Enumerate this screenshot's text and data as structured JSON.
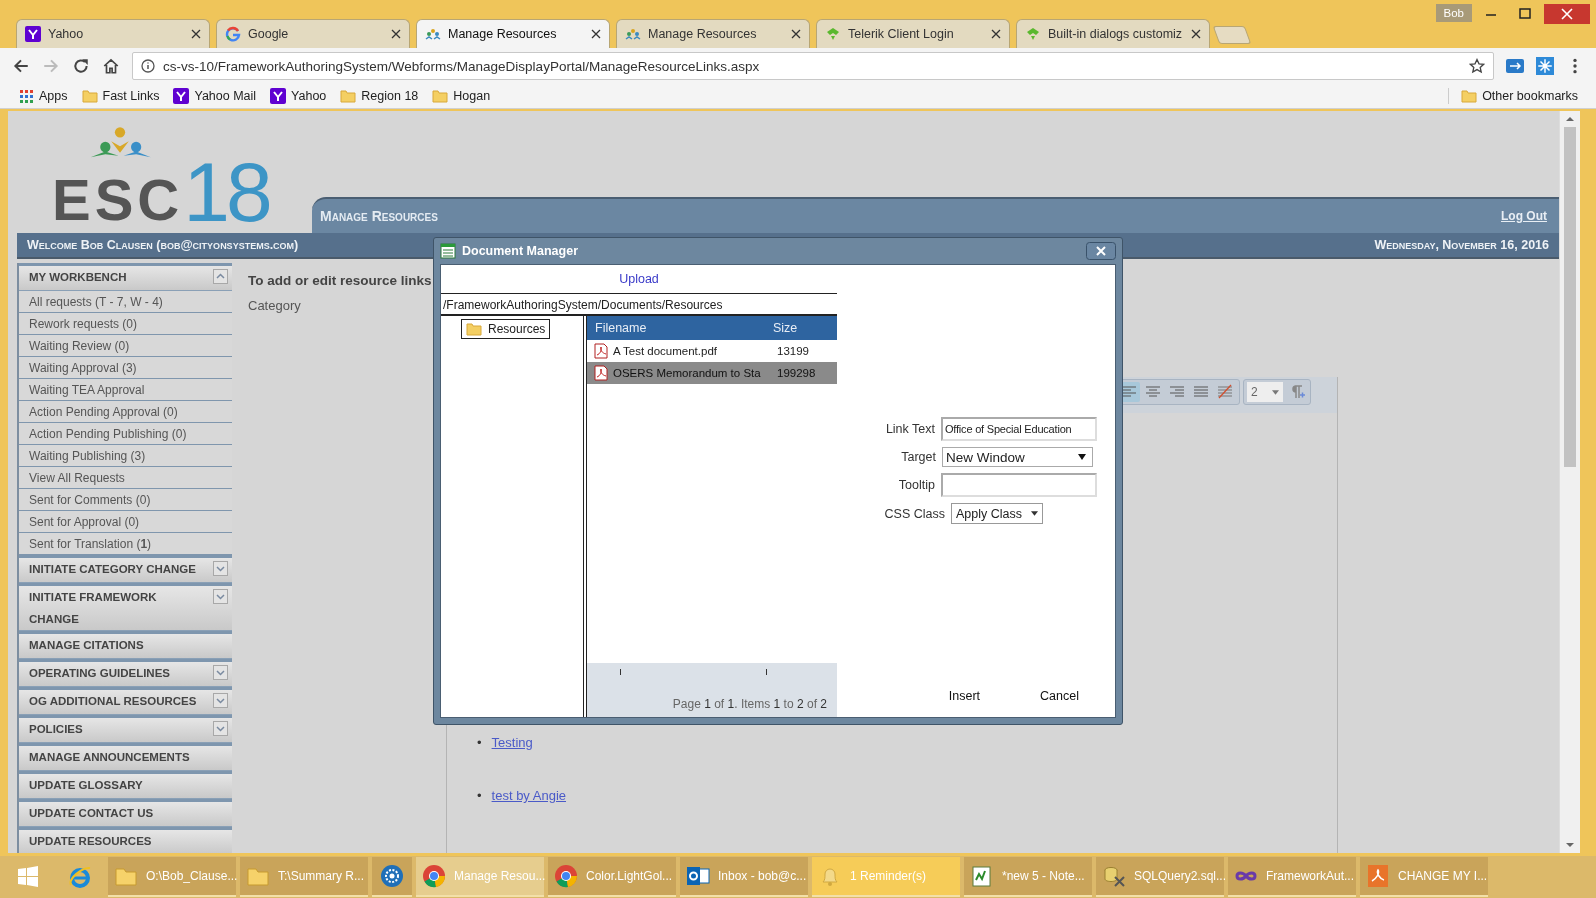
{
  "browser": {
    "profile": "Bob",
    "tabs": [
      {
        "title": "Yahoo",
        "kind": "yahoo",
        "selected": false
      },
      {
        "title": "Google",
        "kind": "google",
        "selected": false
      },
      {
        "title": "Manage Resources",
        "kind": "esc",
        "selected": true
      },
      {
        "title": "Manage Resources",
        "kind": "esc",
        "selected": false
      },
      {
        "title": "Telerik Client Login",
        "kind": "telerik",
        "selected": false
      },
      {
        "title": "Built-in dialogs customiz",
        "kind": "telerik",
        "selected": false
      }
    ],
    "address": "cs-vs-10/FrameworkAuthoringSystem/Webforms/ManageDisplayPortal/ManageResourceLinks.aspx",
    "bookmarks": [
      {
        "label": "Apps",
        "kind": "apps"
      },
      {
        "label": "Fast Links",
        "kind": "folder"
      },
      {
        "label": "Yahoo Mail",
        "kind": "yahoo"
      },
      {
        "label": "Yahoo",
        "kind": "yahoo"
      },
      {
        "label": "Region 18",
        "kind": "folder"
      },
      {
        "label": "Hogan",
        "kind": "folder"
      }
    ],
    "other_bookmarks": "Other bookmarks"
  },
  "page": {
    "logo_letters": "ESC",
    "logo_number": "18",
    "header_title": "Manage Resources",
    "logout": "Log Out",
    "welcome": "Welcome Bob Clausen (bob@cityonsystems.com)",
    "date": "Wednesday, November 16, 2016"
  },
  "sidebar": [
    {
      "label": "MY WORKBENCH",
      "kind": "collapsible",
      "expanded": true,
      "children": [
        "All requests (T - 7, W - 4)",
        "Rework requests (0)",
        "Waiting Review (0)",
        "Waiting Approval (3)",
        "Waiting TEA Approval",
        "Action Pending Approval (0)",
        "Action Pending Publishing (0)",
        "Waiting Publishing (3)",
        "View All Requests",
        "Sent for Comments (0)",
        "Sent for Approval (0)",
        "Sent for Translation (**1**)"
      ]
    },
    {
      "label": "INITIATE CATEGORY CHANGE",
      "kind": "collapsible",
      "expanded": false
    },
    {
      "label": "INITIATE FRAMEWORK CHANGE",
      "kind": "collapsible",
      "expanded": false
    },
    {
      "label": "MANAGE CITATIONS",
      "kind": "link"
    },
    {
      "label": "OPERATING GUIDELINES",
      "kind": "collapsible",
      "expanded": false
    },
    {
      "label": "OG ADDITIONAL RESOURCES",
      "kind": "collapsible",
      "expanded": false
    },
    {
      "label": "POLICIES",
      "kind": "collapsible",
      "expanded": false
    },
    {
      "label": "MANAGE ANNOUNCEMENTS",
      "kind": "link"
    },
    {
      "label": "UPDATE GLOSSARY",
      "kind": "link"
    },
    {
      "label": "UPDATE CONTACT US",
      "kind": "link"
    },
    {
      "label": "UPDATE RESOURCES",
      "kind": "link"
    }
  ],
  "main": {
    "intro": "To add or edit resource links",
    "category_label": "Category",
    "font_size": "2",
    "links": [
      {
        "bullet": "•",
        "text": "Testing"
      },
      {
        "bullet": "•",
        "text": "test by Angie"
      }
    ]
  },
  "dialog": {
    "title": "Document Manager",
    "upload": "Upload",
    "path": "/FrameworkAuthoringSystem/Documents/Resources",
    "folder": "Resources",
    "columns": [
      "Filename",
      "Size"
    ],
    "files": [
      {
        "name": "A Test document.pdf",
        "size": "13199",
        "selected": false
      },
      {
        "name": "OSERS Memorandum to Sta",
        "size": "199298",
        "selected": true
      }
    ],
    "pager": "Page **1** of **1**. Items **1** to **2** of **2**",
    "fields": [
      {
        "label": "Link Text",
        "kind": "text",
        "value": "Office of Special Education"
      },
      {
        "label": "Target",
        "kind": "select",
        "value": "New Window"
      },
      {
        "label": "Tooltip",
        "kind": "text"
      },
      {
        "label": "CSS Class",
        "kind": "dropdown",
        "value": "Apply Class"
      }
    ],
    "buttons": [
      "Insert",
      "Cancel"
    ]
  },
  "taskbar": {
    "pinned": [
      {
        "kind": "start"
      },
      {
        "kind": "ie"
      }
    ],
    "items": [
      {
        "label": "O:\\Bob_Clause...",
        "kind": "folder",
        "selected": false,
        "flashing": false
      },
      {
        "label": "T:\\Summary R...",
        "kind": "folder",
        "selected": false,
        "flashing": false
      },
      {
        "kind": "gear",
        "selected": false,
        "flashing": false
      },
      {
        "label": "Manage Resou...",
        "kind": "chrome",
        "selected": true,
        "flashing": false
      },
      {
        "label": "Color.LightGol...",
        "kind": "chrome",
        "selected": false,
        "flashing": false
      },
      {
        "label": "Inbox - bob@c...",
        "kind": "outlook",
        "selected": false,
        "flashing": false
      },
      {
        "label": "1 Reminder(s)",
        "kind": "bell",
        "selected": false,
        "flashing": true
      },
      {
        "label": "*new  5 - Note...",
        "kind": "notepad",
        "selected": false,
        "flashing": false
      },
      {
        "label": "SQLQuery2.sql...",
        "kind": "sql",
        "selected": false,
        "flashing": false
      },
      {
        "label": "FrameworkAut...",
        "kind": "vs",
        "selected": false,
        "flashing": false
      },
      {
        "label": "CHANGE MY I...",
        "kind": "pdf",
        "selected": false,
        "flashing": false
      }
    ]
  }
}
